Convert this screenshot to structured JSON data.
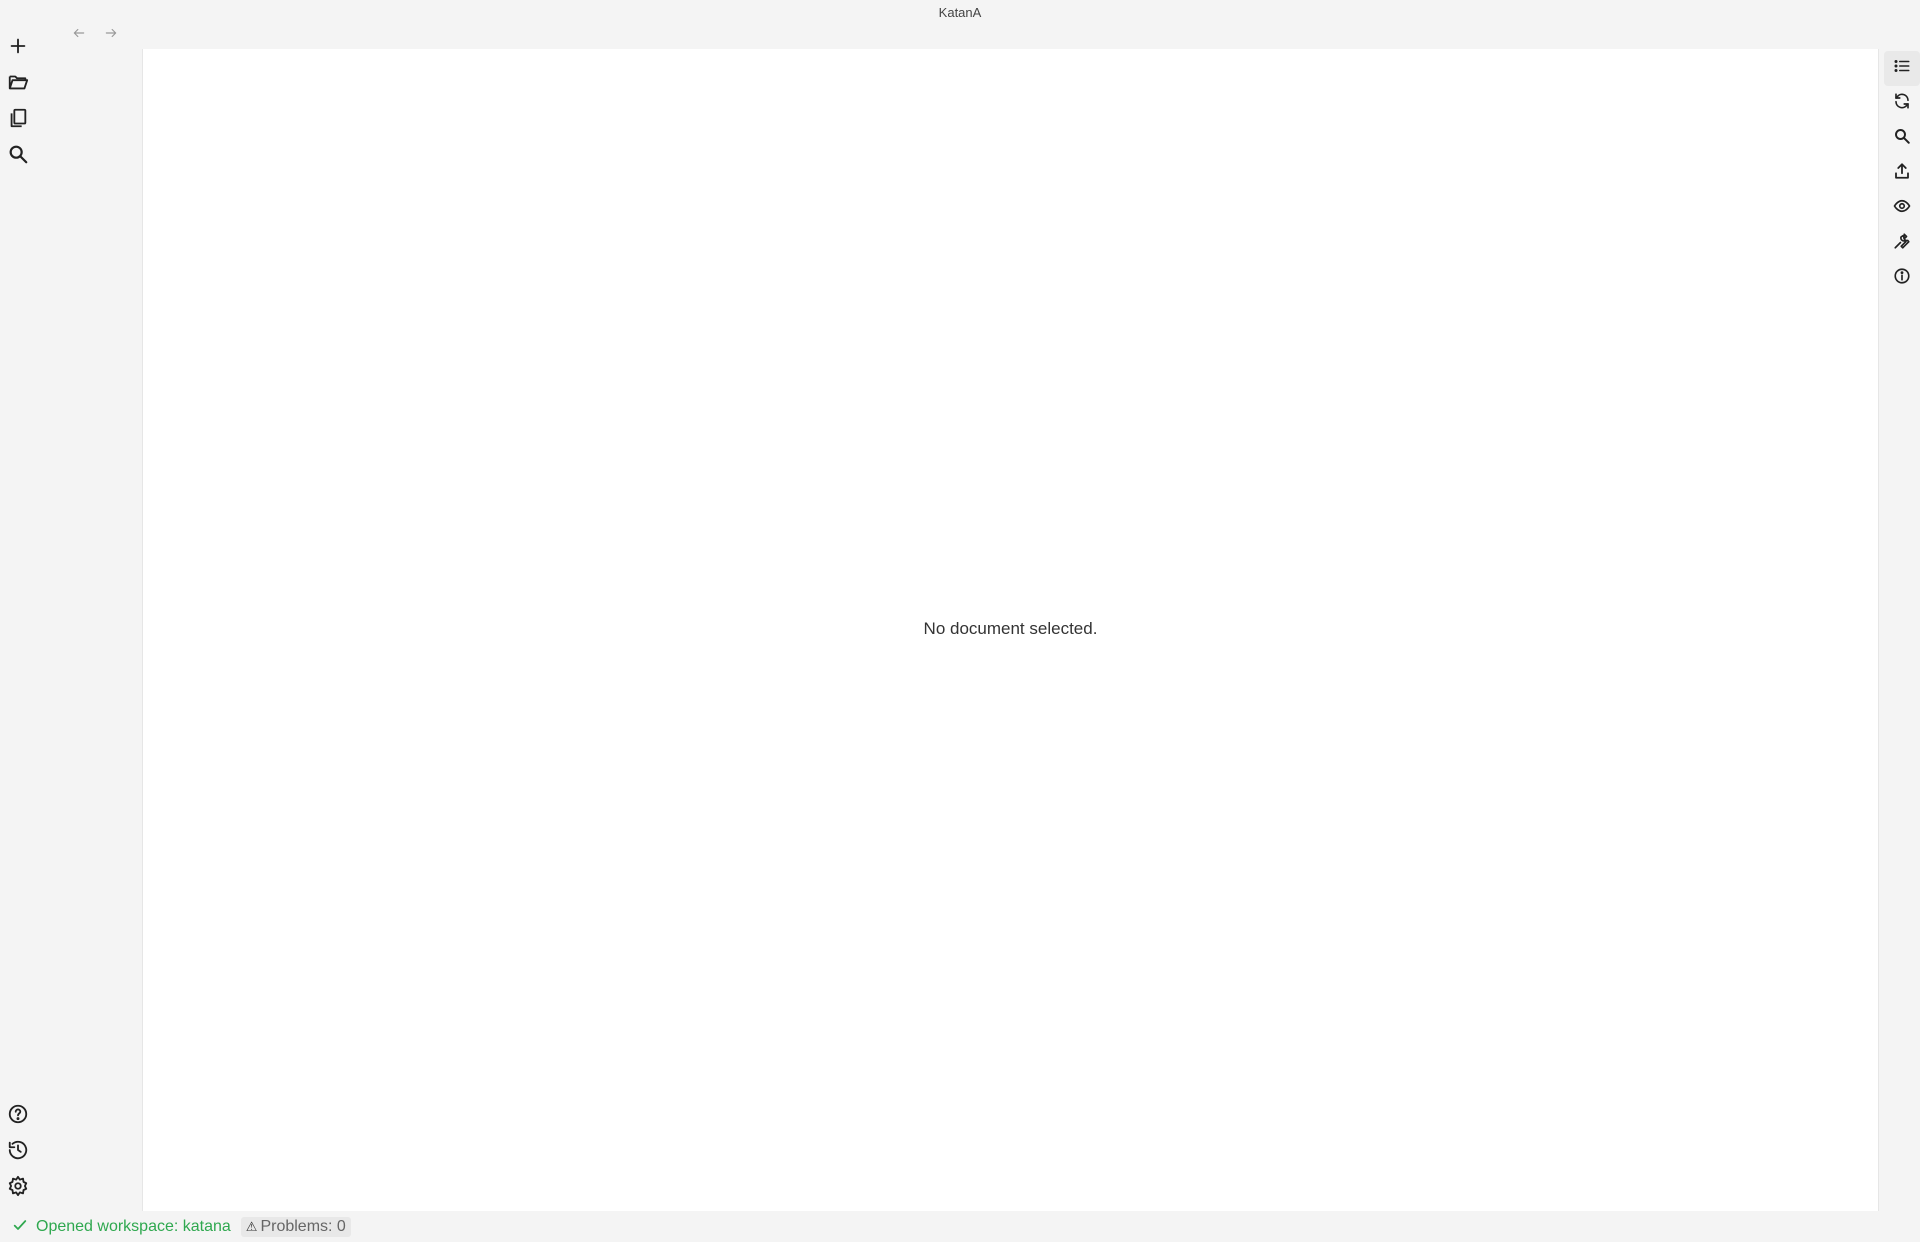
{
  "window": {
    "title": "KatanA"
  },
  "left_rail": {
    "top": [
      {
        "name": "new-file-button",
        "icon": "plus-icon"
      },
      {
        "name": "open-folder-button",
        "icon": "folder-open-icon"
      },
      {
        "name": "documents-button",
        "icon": "copy-icon"
      },
      {
        "name": "search-button",
        "icon": "search-icon"
      }
    ],
    "bottom": [
      {
        "name": "help-button",
        "icon": "help-circle-icon"
      },
      {
        "name": "history-button",
        "icon": "history-icon"
      },
      {
        "name": "settings-button",
        "icon": "gear-icon"
      }
    ]
  },
  "nav": {
    "back_icon": "arrow-left-icon",
    "forward_icon": "arrow-right-icon"
  },
  "editor": {
    "empty_message": "No document selected."
  },
  "right_rail": [
    {
      "name": "outline-button",
      "icon": "list-icon",
      "active": true
    },
    {
      "name": "refresh-button",
      "icon": "refresh-icon"
    },
    {
      "name": "find-button",
      "icon": "search-icon"
    },
    {
      "name": "export-button",
      "icon": "upload-icon"
    },
    {
      "name": "preview-button",
      "icon": "eye-icon"
    },
    {
      "name": "tools-button",
      "icon": "wrench-icon"
    },
    {
      "name": "info-button",
      "icon": "info-icon"
    }
  ],
  "statusbar": {
    "message": "Opened workspace: katana",
    "problems_icon": "⚠",
    "problems_label": "Problems: 0"
  },
  "colors": {
    "background": "#f4f4f4",
    "editor": "#ffffff",
    "success": "#2fa84f"
  }
}
